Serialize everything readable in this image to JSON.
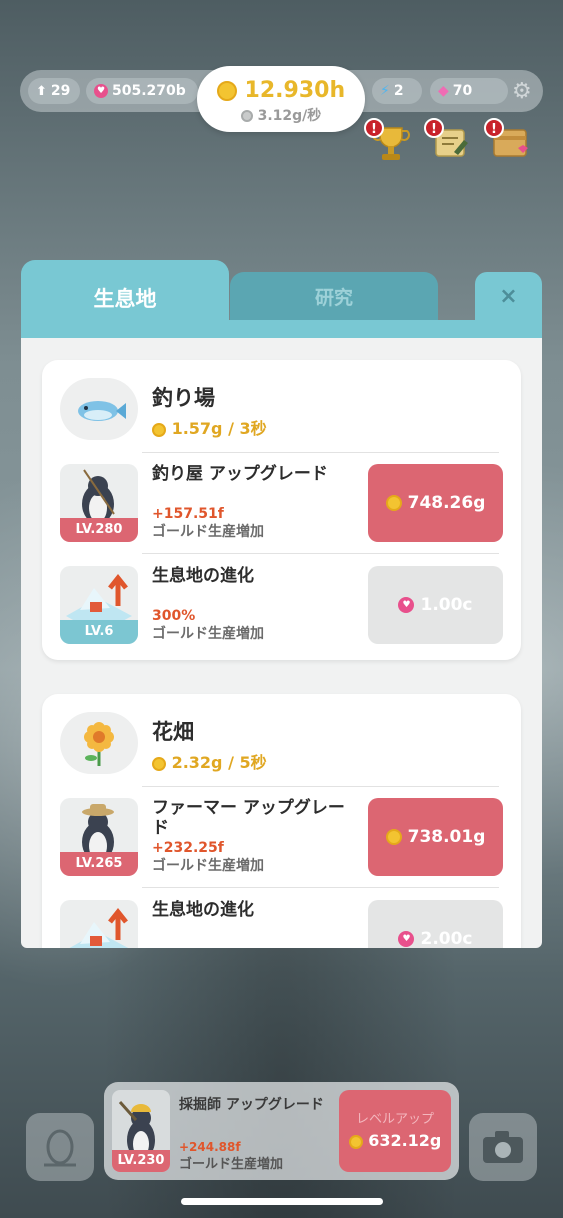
{
  "stats": {
    "arrows": "29",
    "hearts": "505.270b",
    "gold": "12.930h",
    "gold_rate": "3.12g/秒",
    "energy": "2",
    "gems": "70"
  },
  "tabs": {
    "habitat": "生息地",
    "research": "研究",
    "close": "×"
  },
  "cards": [
    {
      "name": "釣り場",
      "rate": "1.57g / 3秒",
      "rows": [
        {
          "title": "釣り屋 アップグレード",
          "level": "LV.280",
          "bonus": "+157.51f",
          "desc": "ゴールド生産増加",
          "price": "748.26g"
        },
        {
          "title": "生息地の進化",
          "level": "LV.6",
          "bonus": "300%",
          "desc": "ゴールド生産増加",
          "price": "1.00c"
        }
      ]
    },
    {
      "name": "花畑",
      "rate": "2.32g / 5秒",
      "rows": [
        {
          "title": "ファーマー アップグレード",
          "level": "LV.265",
          "bonus": "+232.25f",
          "desc": "ゴールド生産増加",
          "price": "738.01g"
        },
        {
          "title": "生息地の進化",
          "level": "",
          "bonus": "",
          "desc": "",
          "price": "2.00c"
        }
      ]
    }
  ],
  "bottom": {
    "title": "採掘師 アップグレード",
    "level": "LV.230",
    "bonus": "+244.88f",
    "desc": "ゴールド生産増加",
    "button_label": "レベルアップ",
    "price": "632.12g"
  },
  "colors": {
    "teal": "#79c8d3",
    "buy_red": "#dc6672",
    "gold_text": "#e0a722",
    "bonus_orange": "#e0562c"
  },
  "icons": [
    "arrow-up-icon",
    "heart-coin-icon",
    "gold-coin-icon",
    "lightning-icon",
    "gem-icon",
    "gear-icon",
    "trophy-icon",
    "quest-scroll-icon",
    "gift-box-icon",
    "fish-icon",
    "flower-icon",
    "egg-icon",
    "camera-icon"
  ]
}
